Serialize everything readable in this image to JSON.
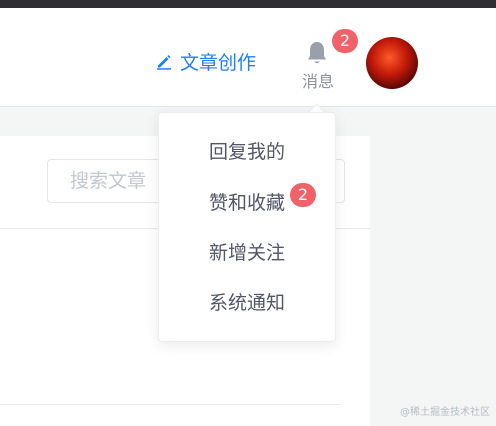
{
  "header": {
    "write_label": "文章创作",
    "notifications": {
      "label": "消息",
      "badge": "2"
    }
  },
  "search": {
    "placeholder": "搜索文章"
  },
  "dropdown": {
    "items": [
      {
        "label": "回复我的"
      },
      {
        "label": "赞和收藏",
        "badge": "2"
      },
      {
        "label": "新增关注"
      },
      {
        "label": "系统通知"
      }
    ]
  },
  "watermark": "@稀土掘金技术社区",
  "colors": {
    "accent": "#1e80ff",
    "badge": "#f0626a",
    "muted_text": "#8a919f"
  },
  "icons": {
    "write": "pencil-icon",
    "notifications": "bell-icon"
  }
}
